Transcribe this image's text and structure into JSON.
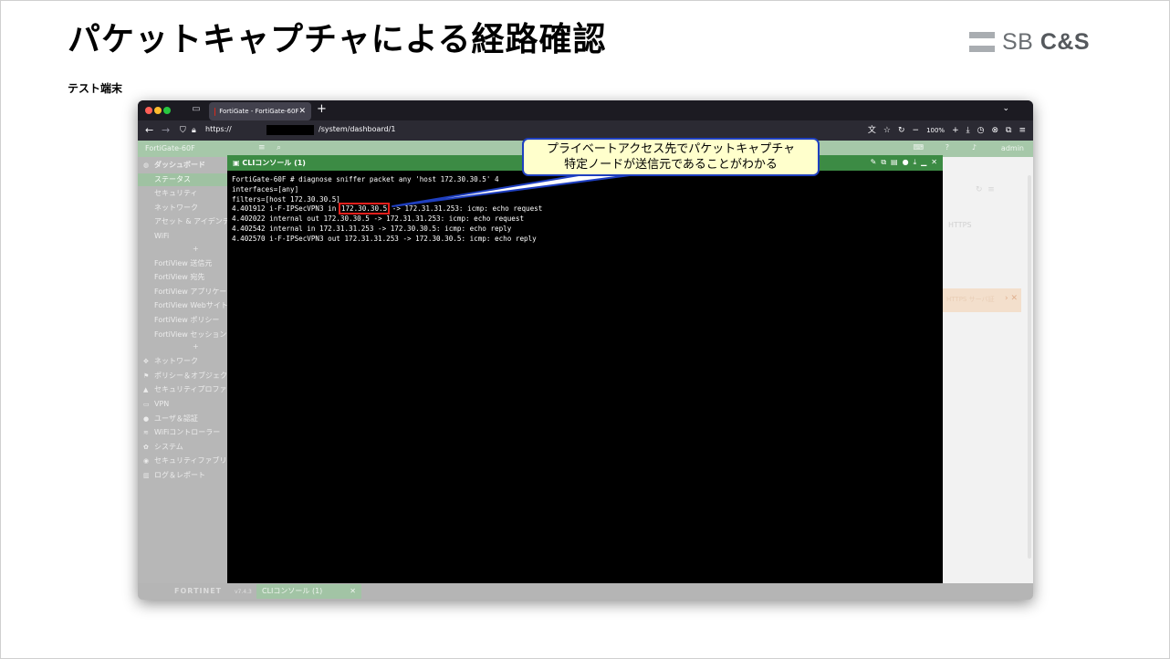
{
  "slide": {
    "title": "パケットキャプチャによる経路確認",
    "subtitle": "テスト端末",
    "logo": {
      "primary": "SB",
      "secondary": "C&S"
    }
  },
  "browser": {
    "tab_title": "FortiGate - FortiGate-60F",
    "new_tab_icon": "+",
    "url_scheme": "https://",
    "url_path": "/system/dashboard/1",
    "zoom": "100%"
  },
  "app": {
    "hostname": "FortiGate-60F",
    "user": "admin",
    "sidebar": [
      {
        "label": "ダッシュボード",
        "level": "top",
        "icon": "dashboard-icon",
        "bold": true
      },
      {
        "label": "ステータス",
        "level": "sub",
        "active": true
      },
      {
        "label": "セキュリティ",
        "level": "sub"
      },
      {
        "label": "ネットワーク",
        "level": "sub"
      },
      {
        "label": "アセット & アイデンティティ",
        "level": "sub"
      },
      {
        "label": "WiFi",
        "level": "sub"
      },
      {
        "label": "FortiView 送信元",
        "level": "sub"
      },
      {
        "label": "FortiView 宛先",
        "level": "sub"
      },
      {
        "label": "FortiView アプリケーション",
        "level": "sub"
      },
      {
        "label": "FortiView Webサイト",
        "level": "sub"
      },
      {
        "label": "FortiView ポリシー",
        "level": "sub"
      },
      {
        "label": "FortiView セッション",
        "level": "sub"
      },
      {
        "label": "ネットワーク",
        "level": "top",
        "icon": "network-icon"
      },
      {
        "label": "ポリシー＆オブジェクト",
        "level": "top",
        "icon": "policy-icon"
      },
      {
        "label": "セキュリティプロファイル",
        "level": "top",
        "icon": "lock-icon"
      },
      {
        "label": "VPN",
        "level": "top",
        "icon": "monitor-icon"
      },
      {
        "label": "ユーザ＆認証",
        "level": "top",
        "icon": "user-icon"
      },
      {
        "label": "WiFiコントローラー",
        "level": "top",
        "icon": "wifi-icon"
      },
      {
        "label": "システム",
        "level": "top",
        "icon": "gear-icon"
      },
      {
        "label": "セキュリティファブリック",
        "level": "top",
        "icon": "fabric-icon"
      },
      {
        "label": "ログ＆レポート",
        "level": "top",
        "icon": "chart-icon"
      }
    ],
    "main": {
      "https_label": "HTTPS",
      "banner_text": "HTTPS サーバ証"
    },
    "footer": {
      "brand": "FORTINET",
      "version": "v7.4.3",
      "tab_label": "CLIコンソール (1)"
    }
  },
  "cli": {
    "title": "CLIコンソール (1)",
    "lines": [
      "FortiGate-60F # diagnose sniffer packet any 'host 172.30.30.5' 4",
      "interfaces=[any]",
      "filters=[host 172.30.30.5]"
    ],
    "highlight_line": {
      "before": "4.401912 i-F-IPSecVPN3 in ",
      "highlight": "172.30.30.5",
      "after": " -> 172.31.31.253: icmp: echo request"
    },
    "tail_lines": [
      "4.402022 internal out 172.30.30.5 -> 172.31.31.253: icmp: echo request",
      "4.402542 internal in 172.31.31.253 -> 172.30.30.5: icmp: echo reply",
      "4.402570 i-F-IPSecVPN3 out 172.31.31.253 -> 172.30.30.5: icmp: echo reply"
    ]
  },
  "callout": {
    "line1": "プライベートアクセス先でパケットキャプチャ",
    "line2": "特定ノードが送信元であることがわかる",
    "border_color": "#1f3fbf",
    "fill_color": "#ffffcc"
  },
  "colors": {
    "cli_header": "#3c8b44",
    "highlight_box": "#e8201c",
    "fortinet_red": "#da291c"
  }
}
